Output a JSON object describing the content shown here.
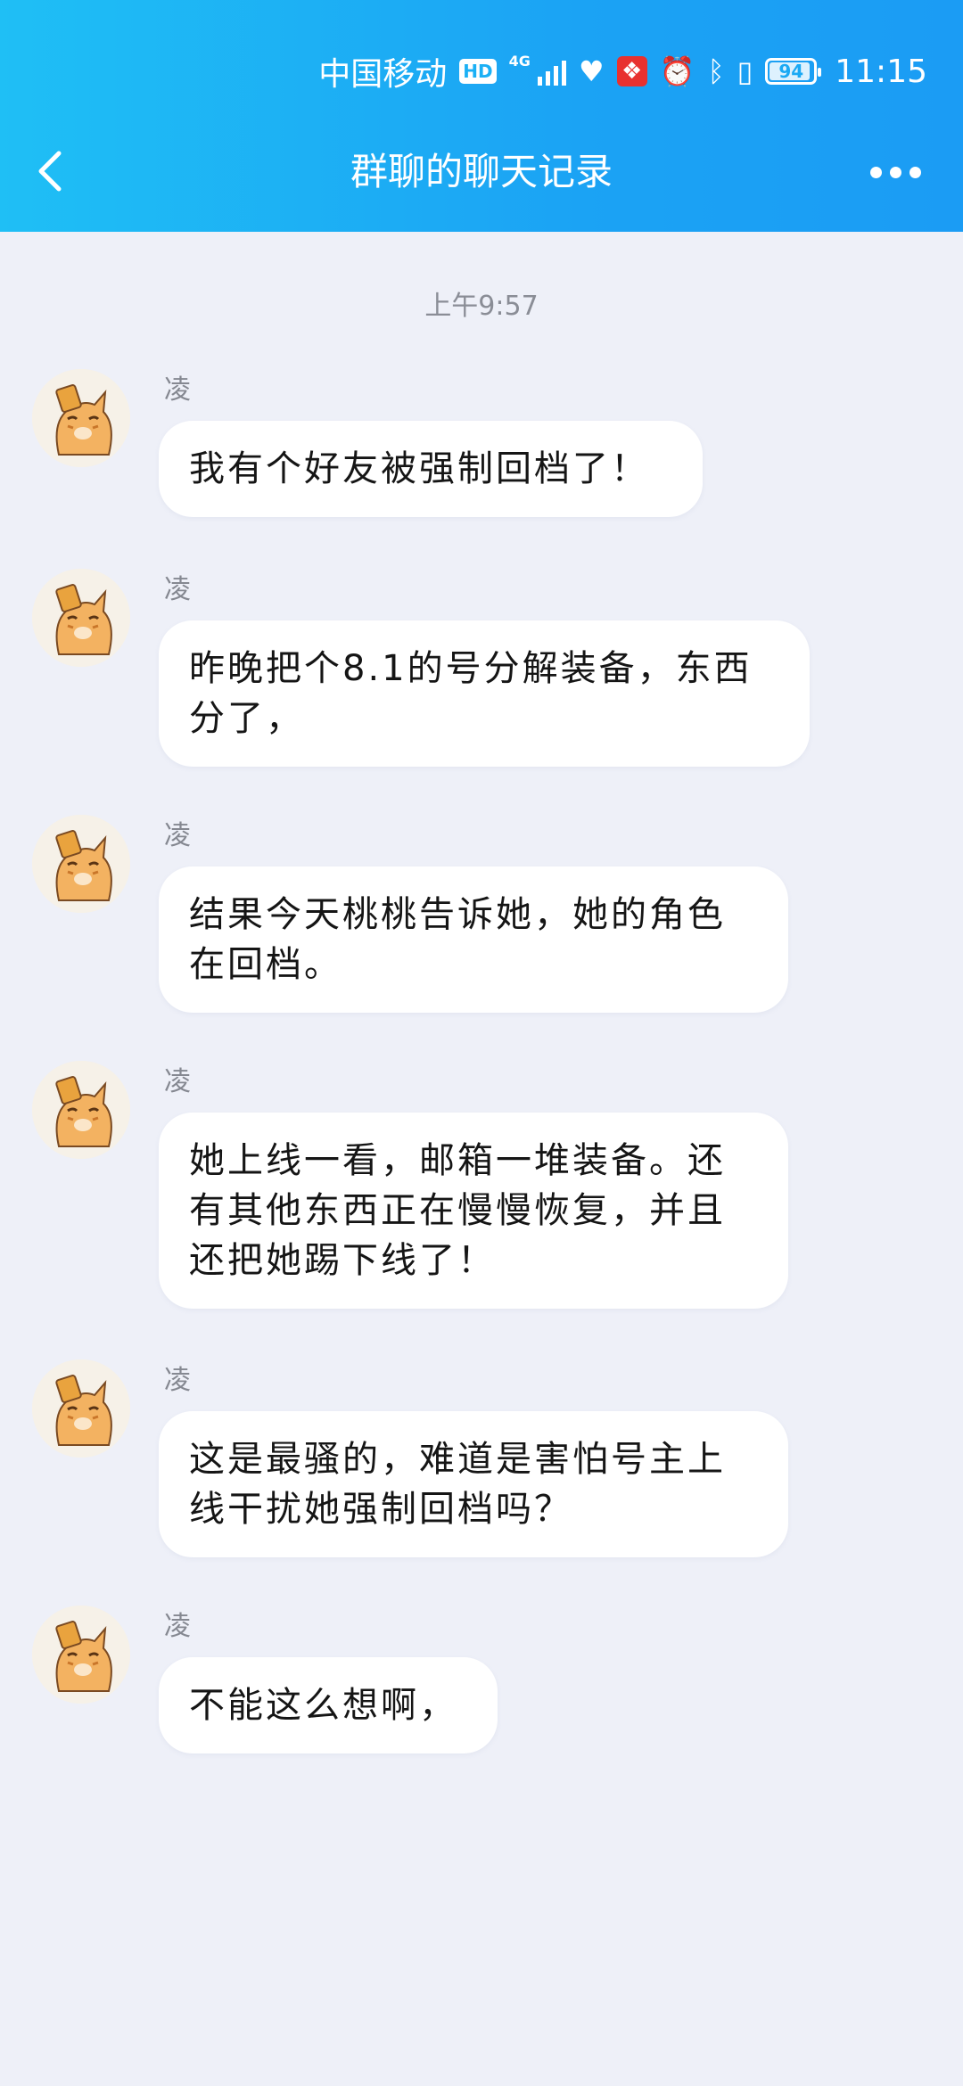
{
  "status_bar": {
    "carrier": "中国移动",
    "hd": "HD",
    "network": "4G",
    "battery": "94",
    "battery_fraction": 0.94,
    "time": "11:15"
  },
  "nav": {
    "title": "群聊的聊天记录"
  },
  "chat": {
    "timestamp": "上午9:57",
    "messages": [
      {
        "sender": "凌",
        "text": "我有个好友被强制回档了！"
      },
      {
        "sender": "凌",
        "text": "昨晚把个8.1的号分解装备，东西分了，"
      },
      {
        "sender": "凌",
        "text": "结果今天桃桃告诉她，她的角色在回档。"
      },
      {
        "sender": "凌",
        "text": "她上线一看，邮箱一堆装备。还有其他东西正在慢慢恢复，并且还把她踢下线了！"
      },
      {
        "sender": "凌",
        "text": "这是最骚的，难道是害怕号主上线干扰她强制回档吗？"
      },
      {
        "sender": "凌",
        "text": "不能这么想啊，"
      }
    ]
  }
}
